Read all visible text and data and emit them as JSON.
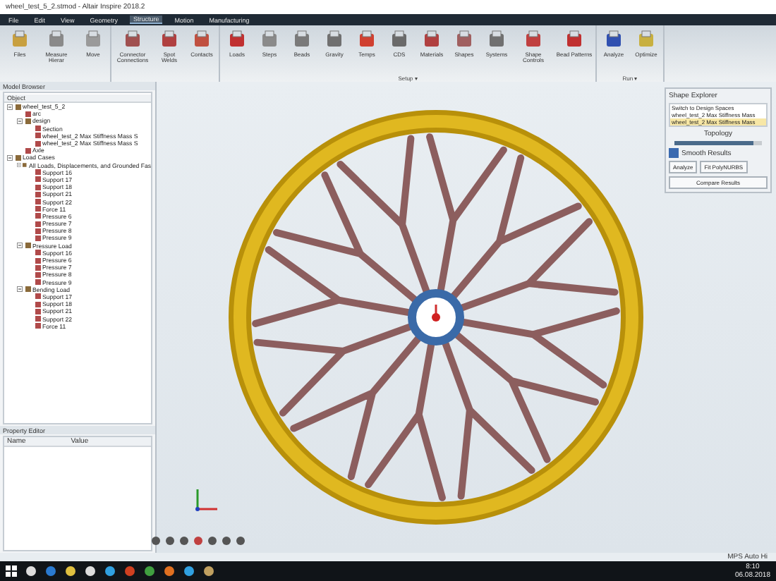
{
  "window": {
    "title": "wheel_test_5_2.stmod - Altair Inspire 2018.2"
  },
  "menu": [
    {
      "label": "File",
      "selected": false
    },
    {
      "label": "Edit",
      "selected": false
    },
    {
      "label": "View",
      "selected": false
    },
    {
      "label": "Geometry",
      "selected": false
    },
    {
      "label": "Structure",
      "selected": true
    },
    {
      "label": "Motion",
      "selected": false
    },
    {
      "label": "Manufacturing",
      "selected": false
    }
  ],
  "ribbon": {
    "groups": [
      {
        "tools": [
          {
            "label": "Files",
            "color": "#c8a040"
          },
          {
            "label": "Measure Hierar",
            "color": "#8a8a8a"
          },
          {
            "label": "Move",
            "color": "#9a9a9a"
          }
        ]
      },
      {
        "tools": [
          {
            "label": "Connector Connections",
            "color": "#a05050"
          },
          {
            "label": "Spot Welds",
            "color": "#b04040"
          },
          {
            "label": "Contacts",
            "color": "#c05040"
          }
        ]
      },
      {
        "label": "Setup ▾",
        "tools": [
          {
            "label": "Loads",
            "color": "#c03030"
          },
          {
            "label": "Steps",
            "color": "#8a8a8a"
          },
          {
            "label": "Beads",
            "color": "#7a7a7a"
          },
          {
            "label": "Gravity",
            "color": "#707070"
          },
          {
            "label": "Temps",
            "color": "#d04030"
          },
          {
            "label": "CDS",
            "color": "#6a6a6a"
          },
          {
            "label": "Materials",
            "color": "#b04040"
          },
          {
            "label": "Shapes",
            "color": "#a06060"
          },
          {
            "label": "Systems",
            "color": "#707070"
          },
          {
            "label": "Shape Controls",
            "color": "#c04040"
          },
          {
            "label": "Bead Patterns",
            "color": "#c03030"
          }
        ]
      },
      {
        "label": "Run ▾",
        "tools": [
          {
            "label": "Analyze",
            "color": "#3050b0"
          },
          {
            "label": "Optimize",
            "color": "#c8b040"
          }
        ]
      }
    ]
  },
  "model_browser": {
    "title": "Model Browser",
    "column": "Object",
    "tree": [
      {
        "label": "wheel_test_5_2",
        "expanded": true,
        "children": [
          {
            "label": "arc"
          },
          {
            "label": "design",
            "expanded": true,
            "children": [
              {
                "label": "Section"
              },
              {
                "label": "wheel_test_2 Max Stiffness Mass S"
              },
              {
                "label": "wheel_test_2 Max Stiffness Mass S"
              }
            ]
          },
          {
            "label": "Axle"
          }
        ]
      },
      {
        "label": "Load Cases",
        "expanded": true,
        "children": [
          {
            "label": "All Loads, Displacements, and Grounded Fas",
            "expanded": true,
            "children": [
              {
                "label": "Support 16"
              },
              {
                "label": "Support 17"
              },
              {
                "label": "Support 18"
              },
              {
                "label": "Support 21"
              },
              {
                "label": "Support 22"
              },
              {
                "label": "Force 11"
              },
              {
                "label": "Pressure 6"
              },
              {
                "label": "Pressure 7"
              },
              {
                "label": "Pressure 8"
              },
              {
                "label": "Pressure 9"
              }
            ]
          },
          {
            "label": "Pressure Load",
            "expanded": true,
            "children": [
              {
                "label": "Support 16"
              },
              {
                "label": "Pressure 6"
              },
              {
                "label": "Pressure 7"
              },
              {
                "label": "Pressure 8"
              },
              {
                "label": "Pressure 9"
              }
            ]
          },
          {
            "label": "Bending Load",
            "expanded": true,
            "children": [
              {
                "label": "Support 17"
              },
              {
                "label": "Support 18"
              },
              {
                "label": "Support 21"
              },
              {
                "label": "Support 22"
              },
              {
                "label": "Force 11"
              }
            ]
          }
        ]
      }
    ]
  },
  "property_editor": {
    "title": "Property Editor",
    "columns": [
      "Name",
      "Value"
    ]
  },
  "shape_explorer": {
    "title": "Shape Explorer",
    "items": [
      {
        "label": "Switch to Design Spaces",
        "selected": false
      },
      {
        "label": "wheel_test_2 Max Stiffness Mass",
        "selected": false
      },
      {
        "label": "wheel_test_2 Max Stiffness Mass",
        "selected": true
      }
    ],
    "slider_label": "Topology",
    "topology": {
      "level": 0.9
    },
    "smooth_results": {
      "label": "Smooth Results",
      "checked": true
    },
    "buttons": [
      "Analyze",
      "Fit PolyNURBS",
      "Compare Results"
    ]
  },
  "status_bar": {
    "text": "MPS Auto Hi"
  },
  "taskbar": {
    "time": "8:10",
    "date": "06.08.2018"
  }
}
